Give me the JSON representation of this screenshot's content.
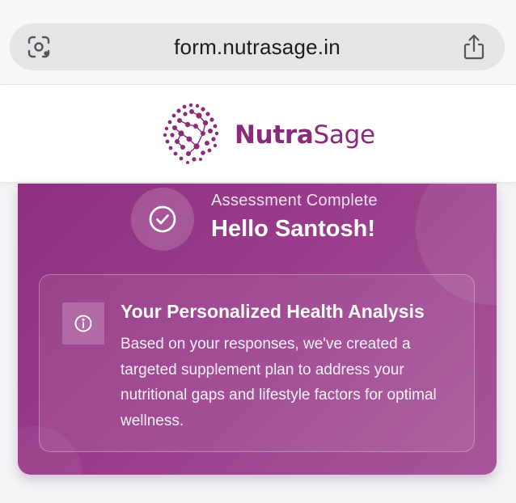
{
  "browser": {
    "url": "form.nutrasage.in",
    "left_icon": "camera-scan-icon",
    "right_icon": "share-icon"
  },
  "header": {
    "brand_bold": "Nutra",
    "brand_regular": "Sage",
    "logo_icon": "molecule-dots-logo",
    "brand_color": "#8a2a7a"
  },
  "result_card": {
    "status": "Assessment Complete",
    "greeting": "Hello Santosh!",
    "badge_icon": "check-circle-icon",
    "analysis": {
      "icon": "info-icon",
      "title": "Your Personalized Health Analysis",
      "body": "Based on your responses, we've created a targeted supplement plan to address your nutritional gaps and lifestyle factors for optimal wellness."
    },
    "gradient_start": "#8f2f7f",
    "gradient_end": "#a7569a"
  }
}
